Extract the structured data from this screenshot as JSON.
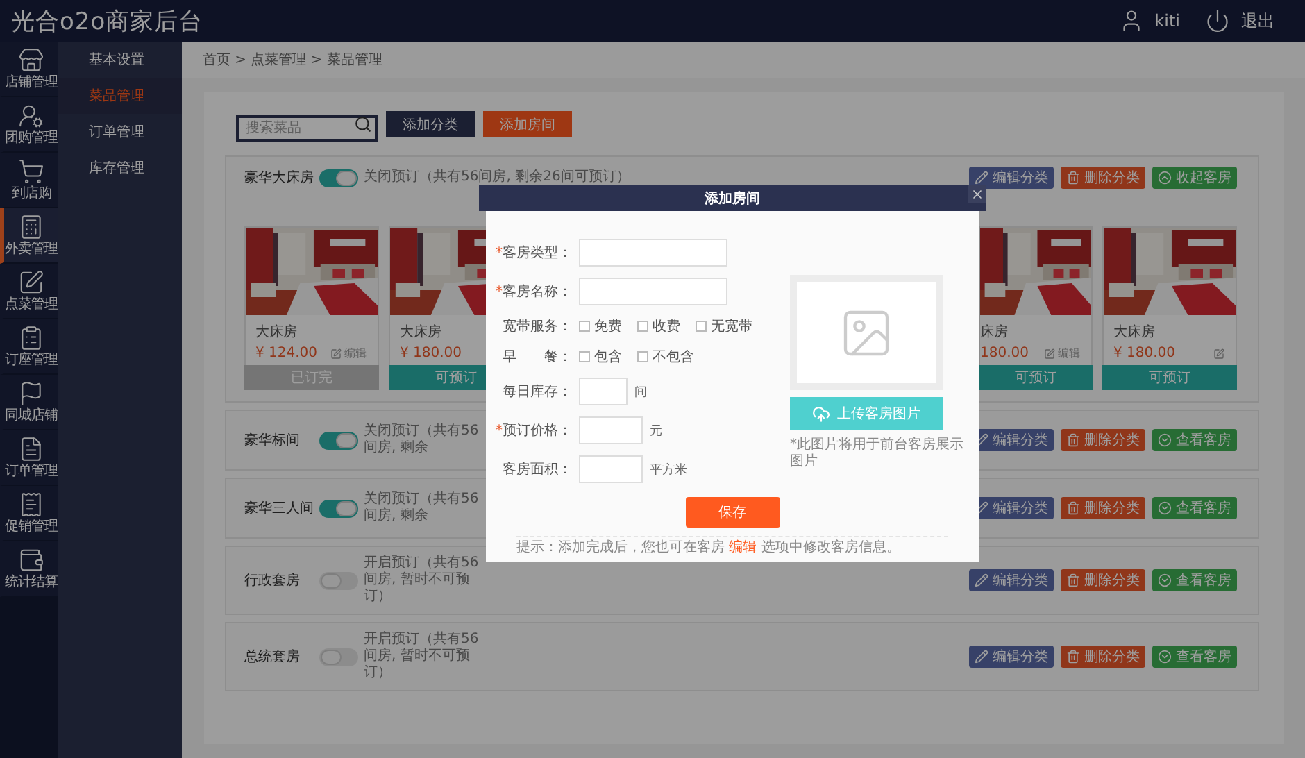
{
  "app": {
    "title": "光合o2o商家后台",
    "user": "kiti",
    "logout": "退出"
  },
  "nav": [
    {
      "label": "店铺管理",
      "selected": false
    },
    {
      "label": "团购管理",
      "selected": false
    },
    {
      "label": "到店购",
      "selected": false
    },
    {
      "label": "外卖管理",
      "selected": true
    },
    {
      "label": "点菜管理",
      "selected": false
    },
    {
      "label": "订座管理",
      "selected": false
    },
    {
      "label": "同城店铺",
      "selected": false
    },
    {
      "label": "订单管理",
      "selected": false
    },
    {
      "label": "促销管理",
      "selected": false
    },
    {
      "label": "统计结算",
      "selected": false
    }
  ],
  "subnav": [
    {
      "label": "基本设置",
      "selected": false
    },
    {
      "label": "菜品管理",
      "selected": true
    },
    {
      "label": "订单管理",
      "selected": false
    },
    {
      "label": "库存管理",
      "selected": false
    }
  ],
  "breadcrumb": "首页 > 点菜管理 > 菜品管理",
  "toolbar": {
    "search": {
      "placeholder": "搜索菜品"
    },
    "buttons": [
      {
        "label": "添加分类",
        "kind": "primary"
      },
      {
        "label": "添加房间",
        "kind": "accent"
      }
    ]
  },
  "sections": [
    {
      "title": "豪华大床房",
      "on": true,
      "expanded": true,
      "status": "关闭预订（共有56间房, 剩余26间可预订）",
      "actions": [
        {
          "kind": "edit",
          "label": "编辑分类"
        },
        {
          "kind": "delete",
          "label": "删除分类"
        },
        {
          "kind": "collapse",
          "label": "收起客房"
        }
      ],
      "cards": [
        {
          "name": "大床房",
          "price": "¥ 124.00",
          "edit": "编辑",
          "available": false,
          "button": "已订完",
          "clipped": false
        },
        {
          "name": "大床房",
          "price": "¥ 180.00",
          "available": true,
          "button": "可预订",
          "clipped": false
        },
        {
          "name": "床房",
          "price": "180.00",
          "edit": "编辑",
          "available": true,
          "button": "可预订",
          "clipped": true
        },
        {
          "name": "大床房",
          "price": "¥ 180.00",
          "edit_icon": true,
          "available": true,
          "button": "可预订",
          "clipped": false
        }
      ]
    },
    {
      "title": "豪华标间",
      "on": true,
      "expanded": false,
      "status": "关闭预订（共有56间房, 剩余",
      "actions": [
        {
          "kind": "edit",
          "label": "编辑分类"
        },
        {
          "kind": "delete",
          "label": "删除分类"
        },
        {
          "kind": "expand",
          "label": "查看客房"
        }
      ]
    },
    {
      "title": "豪华三人间",
      "on": true,
      "expanded": false,
      "status": "关闭预订（共有56间房, 剩余",
      "actions": [
        {
          "kind": "edit",
          "label": "编辑分类"
        },
        {
          "kind": "delete",
          "label": "删除分类"
        },
        {
          "kind": "expand",
          "label": "查看客房"
        }
      ]
    },
    {
      "title": "行政套房",
      "on": false,
      "expanded": false,
      "status": "开启预订（共有56间房, 暂时不可预订）",
      "actions": [
        {
          "kind": "edit",
          "label": "编辑分类"
        },
        {
          "kind": "delete",
          "label": "删除分类"
        },
        {
          "kind": "expand",
          "label": "查看客房"
        }
      ]
    },
    {
      "title": "总统套房",
      "on": false,
      "expanded": false,
      "status": "开启预订（共有56间房, 暂时不可预订）",
      "actions": [
        {
          "kind": "edit",
          "label": "编辑分类"
        },
        {
          "kind": "delete",
          "label": "删除分类"
        },
        {
          "kind": "expand",
          "label": "查看客房"
        }
      ]
    }
  ],
  "dialog": {
    "title": "添加房间",
    "fields": [
      {
        "kind": "text",
        "required_mark": "*",
        "label": "客房类型："
      },
      {
        "kind": "text",
        "required_mark": "*",
        "label": "客房名称："
      },
      {
        "kind": "checks",
        "label": "宽带服务：",
        "options": [
          {
            "label": "免费",
            "checked": false
          },
          {
            "label": "收费",
            "checked": false
          },
          {
            "label": "无宽带",
            "checked": false
          }
        ]
      },
      {
        "kind": "checks",
        "label": "早　　餐：",
        "options": [
          {
            "label": "包含",
            "checked": false
          },
          {
            "label": "不包含",
            "checked": false
          }
        ]
      },
      {
        "kind": "short",
        "label": "每日库存：",
        "unit": "间"
      },
      {
        "kind": "medium",
        "required_mark": "*",
        "label": "预订价格：",
        "unit": "元"
      },
      {
        "kind": "medium",
        "label": "客房面积：",
        "unit": "平方米"
      }
    ],
    "upload": {
      "button": "上传客房图片",
      "note": "*此图片将用于前台客房展示图片"
    },
    "save": "保存",
    "hint": {
      "before": "提示：添加完成后，您也可在客房 ",
      "link": "编辑",
      "after": " 选项中修改客房信息。"
    }
  }
}
